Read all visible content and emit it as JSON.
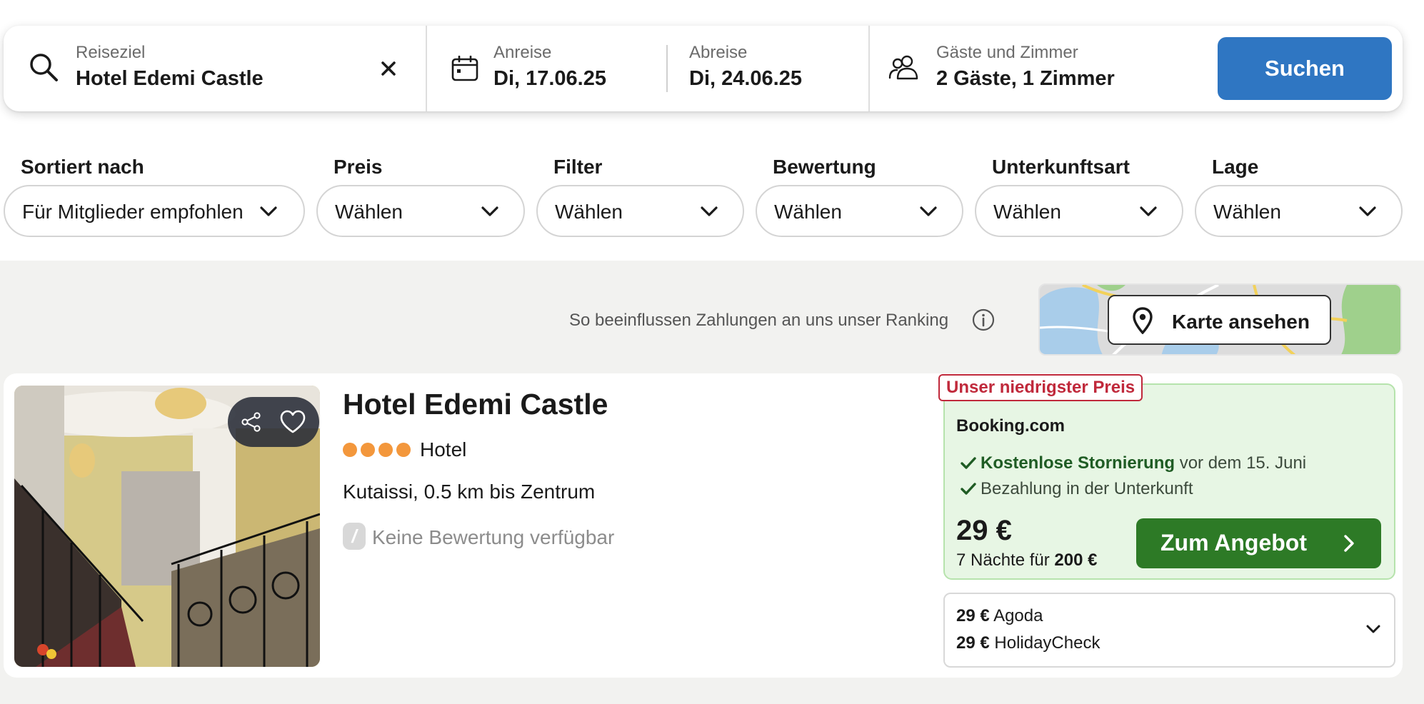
{
  "search": {
    "destination": {
      "label": "Reiseziel",
      "value": "Hotel Edemi Castle"
    },
    "checkin": {
      "label": "Anreise",
      "value": "Di, 17.06.25"
    },
    "checkout": {
      "label": "Abreise",
      "value": "Di, 24.06.25"
    },
    "guests": {
      "label": "Gäste und Zimmer",
      "value": "2 Gäste, 1 Zimmer"
    },
    "search_button": "Suchen"
  },
  "filters": [
    {
      "label": "Sortiert nach",
      "value": "Für Mitglieder empfohlen"
    },
    {
      "label": "Preis",
      "value": "Wählen"
    },
    {
      "label": "Filter",
      "value": "Wählen"
    },
    {
      "label": "Bewertung",
      "value": "Wählen"
    },
    {
      "label": "Unterkunftsart",
      "value": "Wählen"
    },
    {
      "label": "Lage",
      "value": "Wählen"
    }
  ],
  "ranking_info": "So beeinflussen Zahlungen an uns unser Ranking",
  "map_button": "Karte ansehen",
  "hotel": {
    "name": "Hotel Edemi Castle",
    "stars": 4,
    "type": "Hotel",
    "location": "Kutaissi, 0.5 km bis Zentrum",
    "rating_badge": "/",
    "rating_text": "Keine Bewertung verfügbar"
  },
  "deal": {
    "badge": "Unser niedrigster Preis",
    "provider": "Booking.com",
    "perk1_bold": "Kostenlose Stornierung",
    "perk1_rest": "vor dem 15. Juni",
    "perk2": "Bezahlung in der Unterkunft",
    "price": "29 €",
    "nights_prefix": "7 Nächte für",
    "total": "200 €",
    "button": "Zum Angebot"
  },
  "other_offers": [
    {
      "price": "29 €",
      "provider": "Agoda"
    },
    {
      "price": "29 €",
      "provider": "HolidayCheck"
    }
  ],
  "colors": {
    "search_button": "#2f76c2",
    "offer_button": "#2d7a26",
    "badge_red": "#c0293b",
    "star_dots": "#f3973c",
    "deal_bg": "#e7f6e4"
  }
}
